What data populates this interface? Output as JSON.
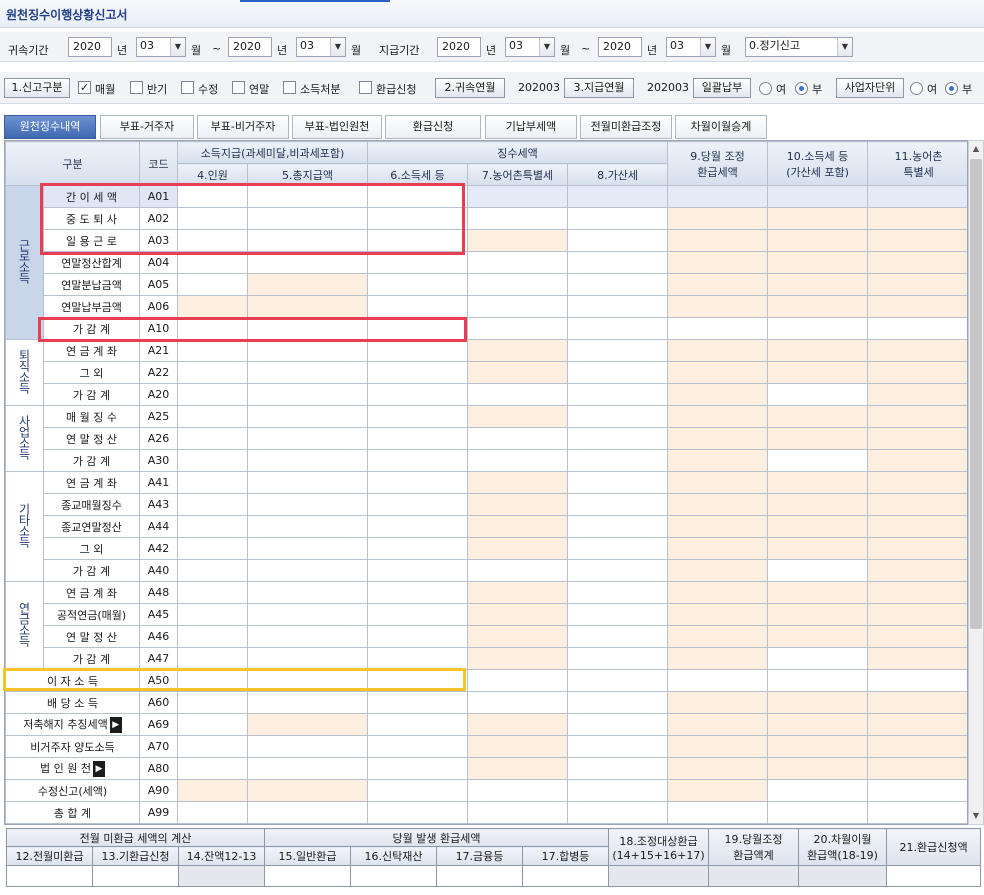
{
  "window": {
    "title": "원천징수이행상황신고서"
  },
  "filter1": {
    "period_label": "귀속기간",
    "year_from": "2020",
    "year_unit": "년",
    "month_from": "03",
    "month_unit": "월",
    "tilde": "~",
    "year_to": "2020",
    "month_to": "03",
    "pay_label": "지급기간",
    "pay_year_from": "2020",
    "pay_month_from": "03",
    "pay_year_to": "2020",
    "pay_month_to": "03",
    "report_type": "0.정기신고"
  },
  "filter2": {
    "btn_type": "1.신고구분",
    "chk_monthly": "매월",
    "chk_monthly_mark": "✓",
    "chk_half": "반기",
    "chk_amend": "수정",
    "chk_yearend": "연말",
    "chk_income": "소득처분",
    "chk_refund": "환급신청",
    "btn_belong": "2.귀속연월",
    "belong_value": "202003",
    "btn_pay": "3.지급연월",
    "pay_value": "202003",
    "btn_batch": "일괄납부",
    "opt_yes": "여",
    "opt_no": "부",
    "btn_unit": "사업자단위",
    "opt_yes2": "여",
    "opt_no2": "부"
  },
  "tabs": [
    "원천징수내역",
    "부표-거주자",
    "부표-비거주자",
    "부표-법인원천",
    "환급신청",
    "기납부세액",
    "전월미환급조정",
    "차월이월승계"
  ],
  "grid": {
    "headers": {
      "category": "구분",
      "code": "코드",
      "income_group": "소득지급(과세미달,비과세포함)",
      "tax_group": "징수세액",
      "h4": "4.인원",
      "h5": "5.총지급액",
      "h6": "6.소득세 등",
      "h7": "7.농어촌특별세",
      "h8": "8.가산세",
      "h9a": "9.당월 조정",
      "h9b": "환급세액",
      "h10a": "10.소득세 등",
      "h10b": "(가산세 포함)",
      "h11a": "11.농어촌",
      "h11b": "특별세"
    },
    "sections": {
      "labor": "근로소득",
      "retire": "퇴직소득",
      "business": "사업소득",
      "other": "기타소득",
      "pension": "연금소득"
    },
    "rows": [
      {
        "label": "간 이 세 액",
        "code": "A01"
      },
      {
        "label": "중 도 퇴 사",
        "code": "A02"
      },
      {
        "label": "일 용 근 로",
        "code": "A03"
      },
      {
        "label": "연말정산합계",
        "code": "A04"
      },
      {
        "label": "연말분납금액",
        "code": "A05"
      },
      {
        "label": "연말납부금액",
        "code": "A06"
      },
      {
        "label": "가  감  계",
        "code": "A10"
      },
      {
        "label": "연 금 계 좌",
        "code": "A21"
      },
      {
        "label": "그 외",
        "code": "A22"
      },
      {
        "label": "가 감 계",
        "code": "A20"
      },
      {
        "label": "매 월 징 수",
        "code": "A25"
      },
      {
        "label": "연 말 정 산",
        "code": "A26"
      },
      {
        "label": "가  감  계",
        "code": "A30"
      },
      {
        "label": "연 금 계 좌",
        "code": "A41"
      },
      {
        "label": "종교매월징수",
        "code": "A43"
      },
      {
        "label": "종교연말정산",
        "code": "A44"
      },
      {
        "label": "그 외",
        "code": "A42"
      },
      {
        "label": "가  감  계",
        "code": "A40"
      },
      {
        "label": "연 금 계 좌",
        "code": "A48"
      },
      {
        "label": "공적연금(매월)",
        "code": "A45"
      },
      {
        "label": "연 말 정 산",
        "code": "A46"
      },
      {
        "label": "가  감  계",
        "code": "A47"
      },
      {
        "label": "이 자 소 득",
        "code": "A50"
      },
      {
        "label": "배 당 소 득",
        "code": "A60"
      },
      {
        "label": "저축해지 추징세액",
        "code": "A69"
      },
      {
        "label": "비거주자 양도소득",
        "code": "A70"
      },
      {
        "label": "법 인 원 천",
        "code": "A80"
      },
      {
        "label": "수정신고(세액)",
        "code": "A90"
      },
      {
        "label": "총  합  계",
        "code": "A99"
      }
    ],
    "arrow": "▶"
  },
  "bottom": {
    "g1": "전월 미환급 세액의 계산",
    "g2": "당월 발생 환급세액",
    "c12": "12.전월미환급",
    "c13": "13.기환급신청",
    "c14": "14.잔액12-13",
    "c15": "15.일반환급",
    "c16": "16.신탁재산",
    "c17a": "17.금융등",
    "c17b": "17.합병등",
    "c18a": "18.조정대상환급",
    "c18b": "(14+15+16+17)",
    "c19a": "19.당월조정",
    "c19b": "환급액계",
    "c20a": "20.차월이월",
    "c20b": "환급액(18-19)",
    "c21": "21.환급신청액"
  }
}
